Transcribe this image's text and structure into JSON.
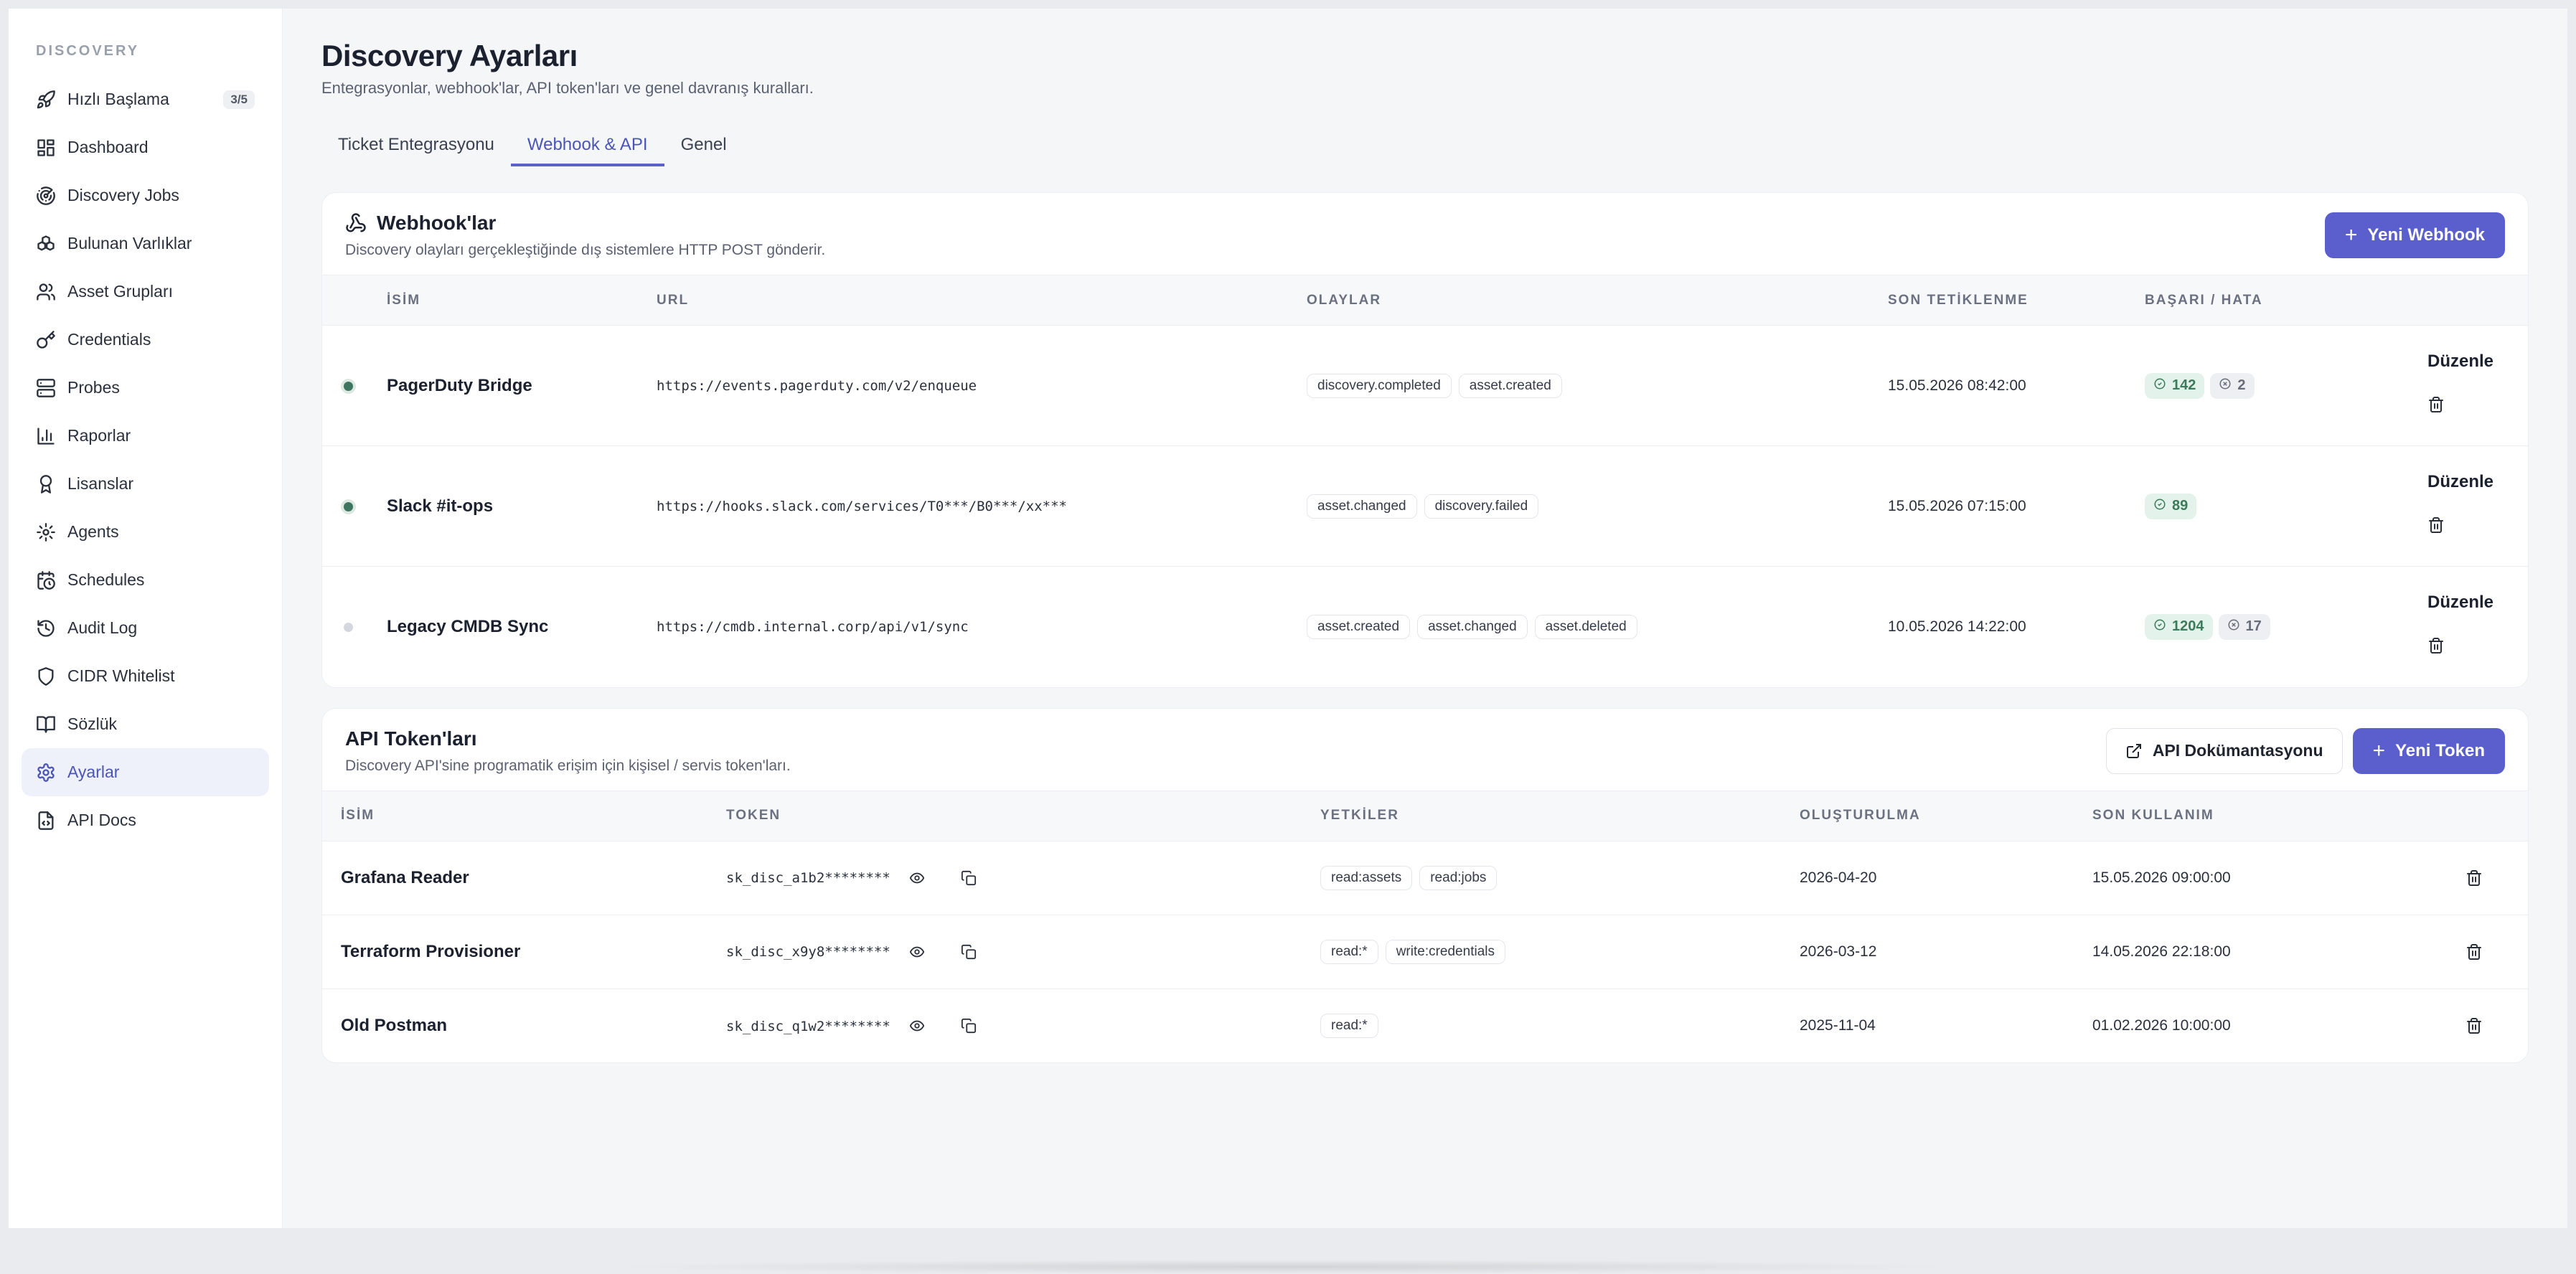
{
  "sidebar": {
    "section": "DISCOVERY",
    "items": [
      {
        "label": "Hızlı Başlama",
        "icon": "rocket-icon",
        "badge": "3/5"
      },
      {
        "label": "Dashboard",
        "icon": "layout-grid-icon"
      },
      {
        "label": "Discovery Jobs",
        "icon": "radar-icon"
      },
      {
        "label": "Bulunan Varlıklar",
        "icon": "boxes-icon"
      },
      {
        "label": "Asset Grupları",
        "icon": "users-icon"
      },
      {
        "label": "Credentials",
        "icon": "key-icon"
      },
      {
        "label": "Probes",
        "icon": "server-icon"
      },
      {
        "label": "Raporlar",
        "icon": "bar-chart-icon"
      },
      {
        "label": "Lisanslar",
        "icon": "award-icon"
      },
      {
        "label": "Agents",
        "icon": "cog-icon"
      },
      {
        "label": "Schedules",
        "icon": "calendar-clock-icon"
      },
      {
        "label": "Audit Log",
        "icon": "history-icon"
      },
      {
        "label": "CIDR Whitelist",
        "icon": "shield-icon"
      },
      {
        "label": "Sözlük",
        "icon": "book-icon"
      },
      {
        "label": "Ayarlar",
        "icon": "settings-icon",
        "active": true
      },
      {
        "label": "API Docs",
        "icon": "file-code-icon"
      }
    ]
  },
  "header": {
    "title": "Discovery Ayarları",
    "subtitle": "Entegrasyonlar, webhook'lar, API token'ları ve genel davranış kuralları."
  },
  "tabs": [
    {
      "label": "Ticket Entegrasyonu"
    },
    {
      "label": "Webhook & API",
      "active": true
    },
    {
      "label": "Genel"
    }
  ],
  "webhooks": {
    "title": "Webhook'lar",
    "description": "Discovery olayları gerçekleştiğinde dış sistemlere HTTP POST gönderir.",
    "new_button": "Yeni Webhook",
    "columns": [
      "İSİM",
      "URL",
      "OLAYLAR",
      "SON TETİKLENME",
      "BAŞARI / HATA"
    ],
    "edit_label": "Düzenle",
    "rows": [
      {
        "active": true,
        "name": "PagerDuty Bridge",
        "url": "https://events.pagerduty.com/v2/enqueue",
        "events": [
          "discovery.completed",
          "asset.created"
        ],
        "last": "15.05.2026 08:42:00",
        "success": "142",
        "fail": "2"
      },
      {
        "active": true,
        "name": "Slack #it-ops",
        "url": "https://hooks.slack.com/services/T0***/B0***/xx***",
        "events": [
          "asset.changed",
          "discovery.failed"
        ],
        "last": "15.05.2026 07:15:00",
        "success": "89",
        "fail": null
      },
      {
        "active": false,
        "name": "Legacy CMDB Sync",
        "url": "https://cmdb.internal.corp/api/v1/sync",
        "events": [
          "asset.created",
          "asset.changed",
          "asset.deleted"
        ],
        "last": "10.05.2026 14:22:00",
        "success": "1204",
        "fail": "17"
      }
    ]
  },
  "tokens": {
    "title": "API Token'ları",
    "description": "Discovery API'sine programatik erişim için kişisel / servis token'ları.",
    "docs_button": "API Dokümantasyonu",
    "new_button": "Yeni Token",
    "columns": [
      "İSİM",
      "TOKEN",
      "YETKİLER",
      "OLUŞTURULMA",
      "SON KULLANIM"
    ],
    "rows": [
      {
        "name": "Grafana Reader",
        "token": "sk_disc_a1b2********",
        "scopes": [
          "read:assets",
          "read:jobs"
        ],
        "created": "2026-04-20",
        "last_used": "15.05.2026 09:00:00"
      },
      {
        "name": "Terraform Provisioner",
        "token": "sk_disc_x9y8********",
        "scopes": [
          "read:*",
          "write:credentials"
        ],
        "created": "2026-03-12",
        "last_used": "14.05.2026 22:18:00"
      },
      {
        "name": "Old Postman",
        "token": "sk_disc_q1w2********",
        "scopes": [
          "read:*"
        ],
        "created": "2025-11-04",
        "last_used": "01.02.2026 10:00:00"
      }
    ]
  },
  "colors": {
    "accent": "#5b5fce",
    "success_bg": "#e3f2ea",
    "active_nav_bg": "#eef0fa"
  }
}
